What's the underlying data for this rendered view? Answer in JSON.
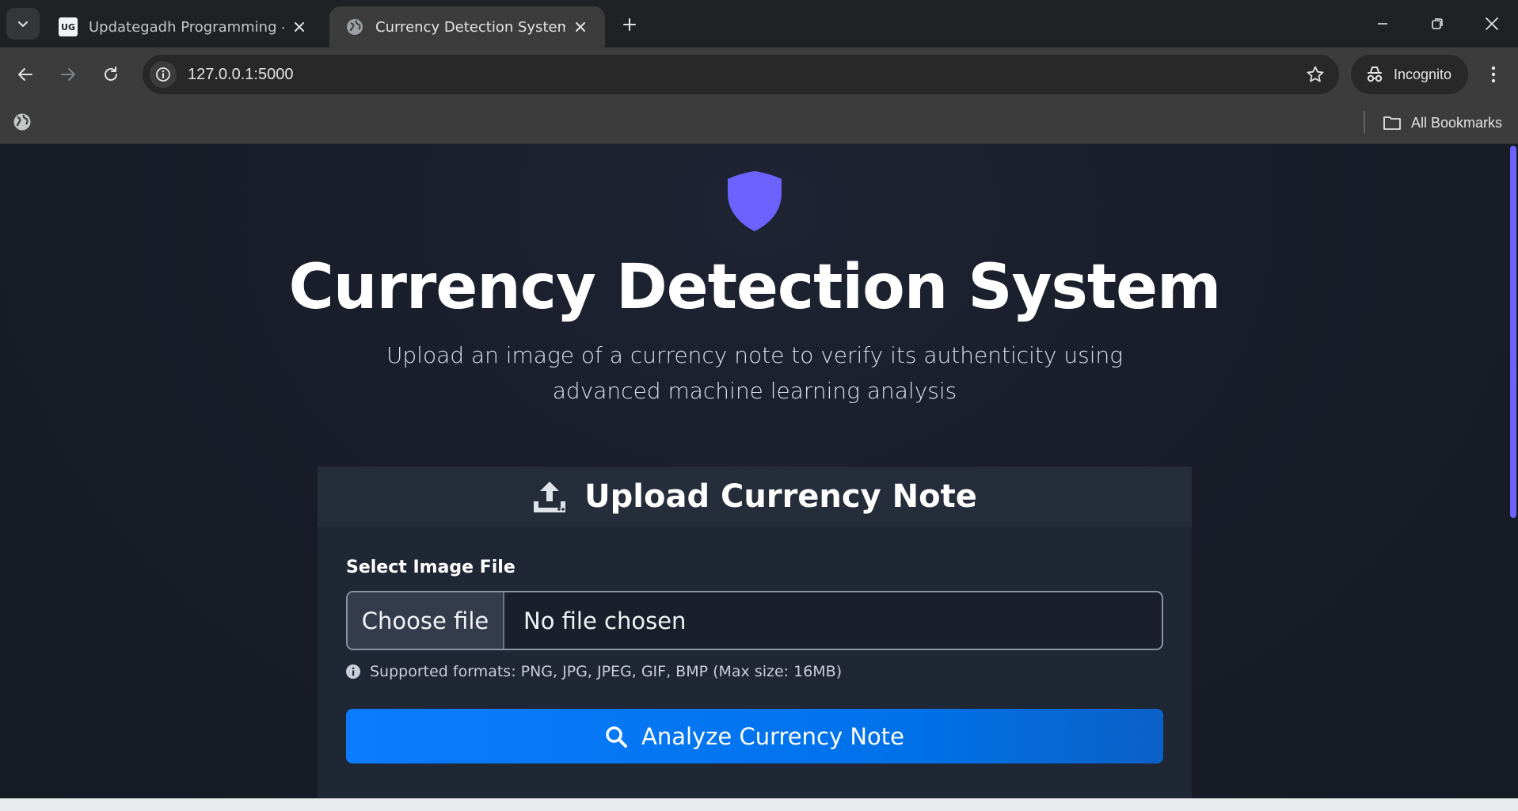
{
  "browser": {
    "tabs": [
      {
        "title": "Updategadh Programming - Up",
        "favicon": "UG",
        "active": false
      },
      {
        "title": "Currency Detection System",
        "favicon": "globe-icon",
        "active": true
      }
    ],
    "url": "127.0.0.1:5000",
    "incognito_label": "Incognito",
    "bookmarks_label": "All Bookmarks"
  },
  "page": {
    "title": "Currency Detection System",
    "subtitle": "Upload an image of a currency note to verify its authenticity using advanced machine learning analysis",
    "card": {
      "heading": "Upload Currency Note",
      "field_label": "Select Image File",
      "choose_button": "Choose file",
      "file_status": "No file chosen",
      "hint": "Supported formats: PNG, JPG, JPEG, GIF, BMP (Max size: 16MB)",
      "submit_label": "Analyze Currency Note"
    }
  },
  "colors": {
    "accent": "#6c63ff",
    "button": "#0a7dff",
    "background": "#181c27"
  }
}
